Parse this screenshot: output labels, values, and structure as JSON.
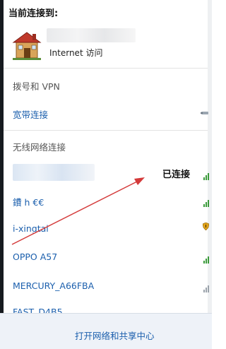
{
  "header": {
    "title": "当前连接到:",
    "current_network_status": "Internet 访问"
  },
  "dialup": {
    "section_label": "拨号和 VPN",
    "items": [
      {
        "label": "宽带连接"
      }
    ]
  },
  "wireless": {
    "section_label": "无线网络连接",
    "connected_status": "已连接",
    "networks": [
      {
        "name": "鐨 h €€",
        "signal": "strong"
      },
      {
        "name": "i-xingtai",
        "signal": "strong",
        "secured_warning": true
      },
      {
        "name": "OPPO A57",
        "signal": "strong"
      },
      {
        "name": "MERCURY_A66FBA",
        "signal": "weak"
      },
      {
        "name": "FAST_D4B5",
        "signal": "weak"
      }
    ]
  },
  "footer": {
    "open_center_label": "打开网络和共享中心"
  },
  "colors": {
    "link": "#1b5fad",
    "signal_green": "#3a9a3a",
    "annotation_arrow": "#d43a3a"
  },
  "icons": [
    "house-icon",
    "cable-icon",
    "signal-icon",
    "shield-warning-icon"
  ]
}
